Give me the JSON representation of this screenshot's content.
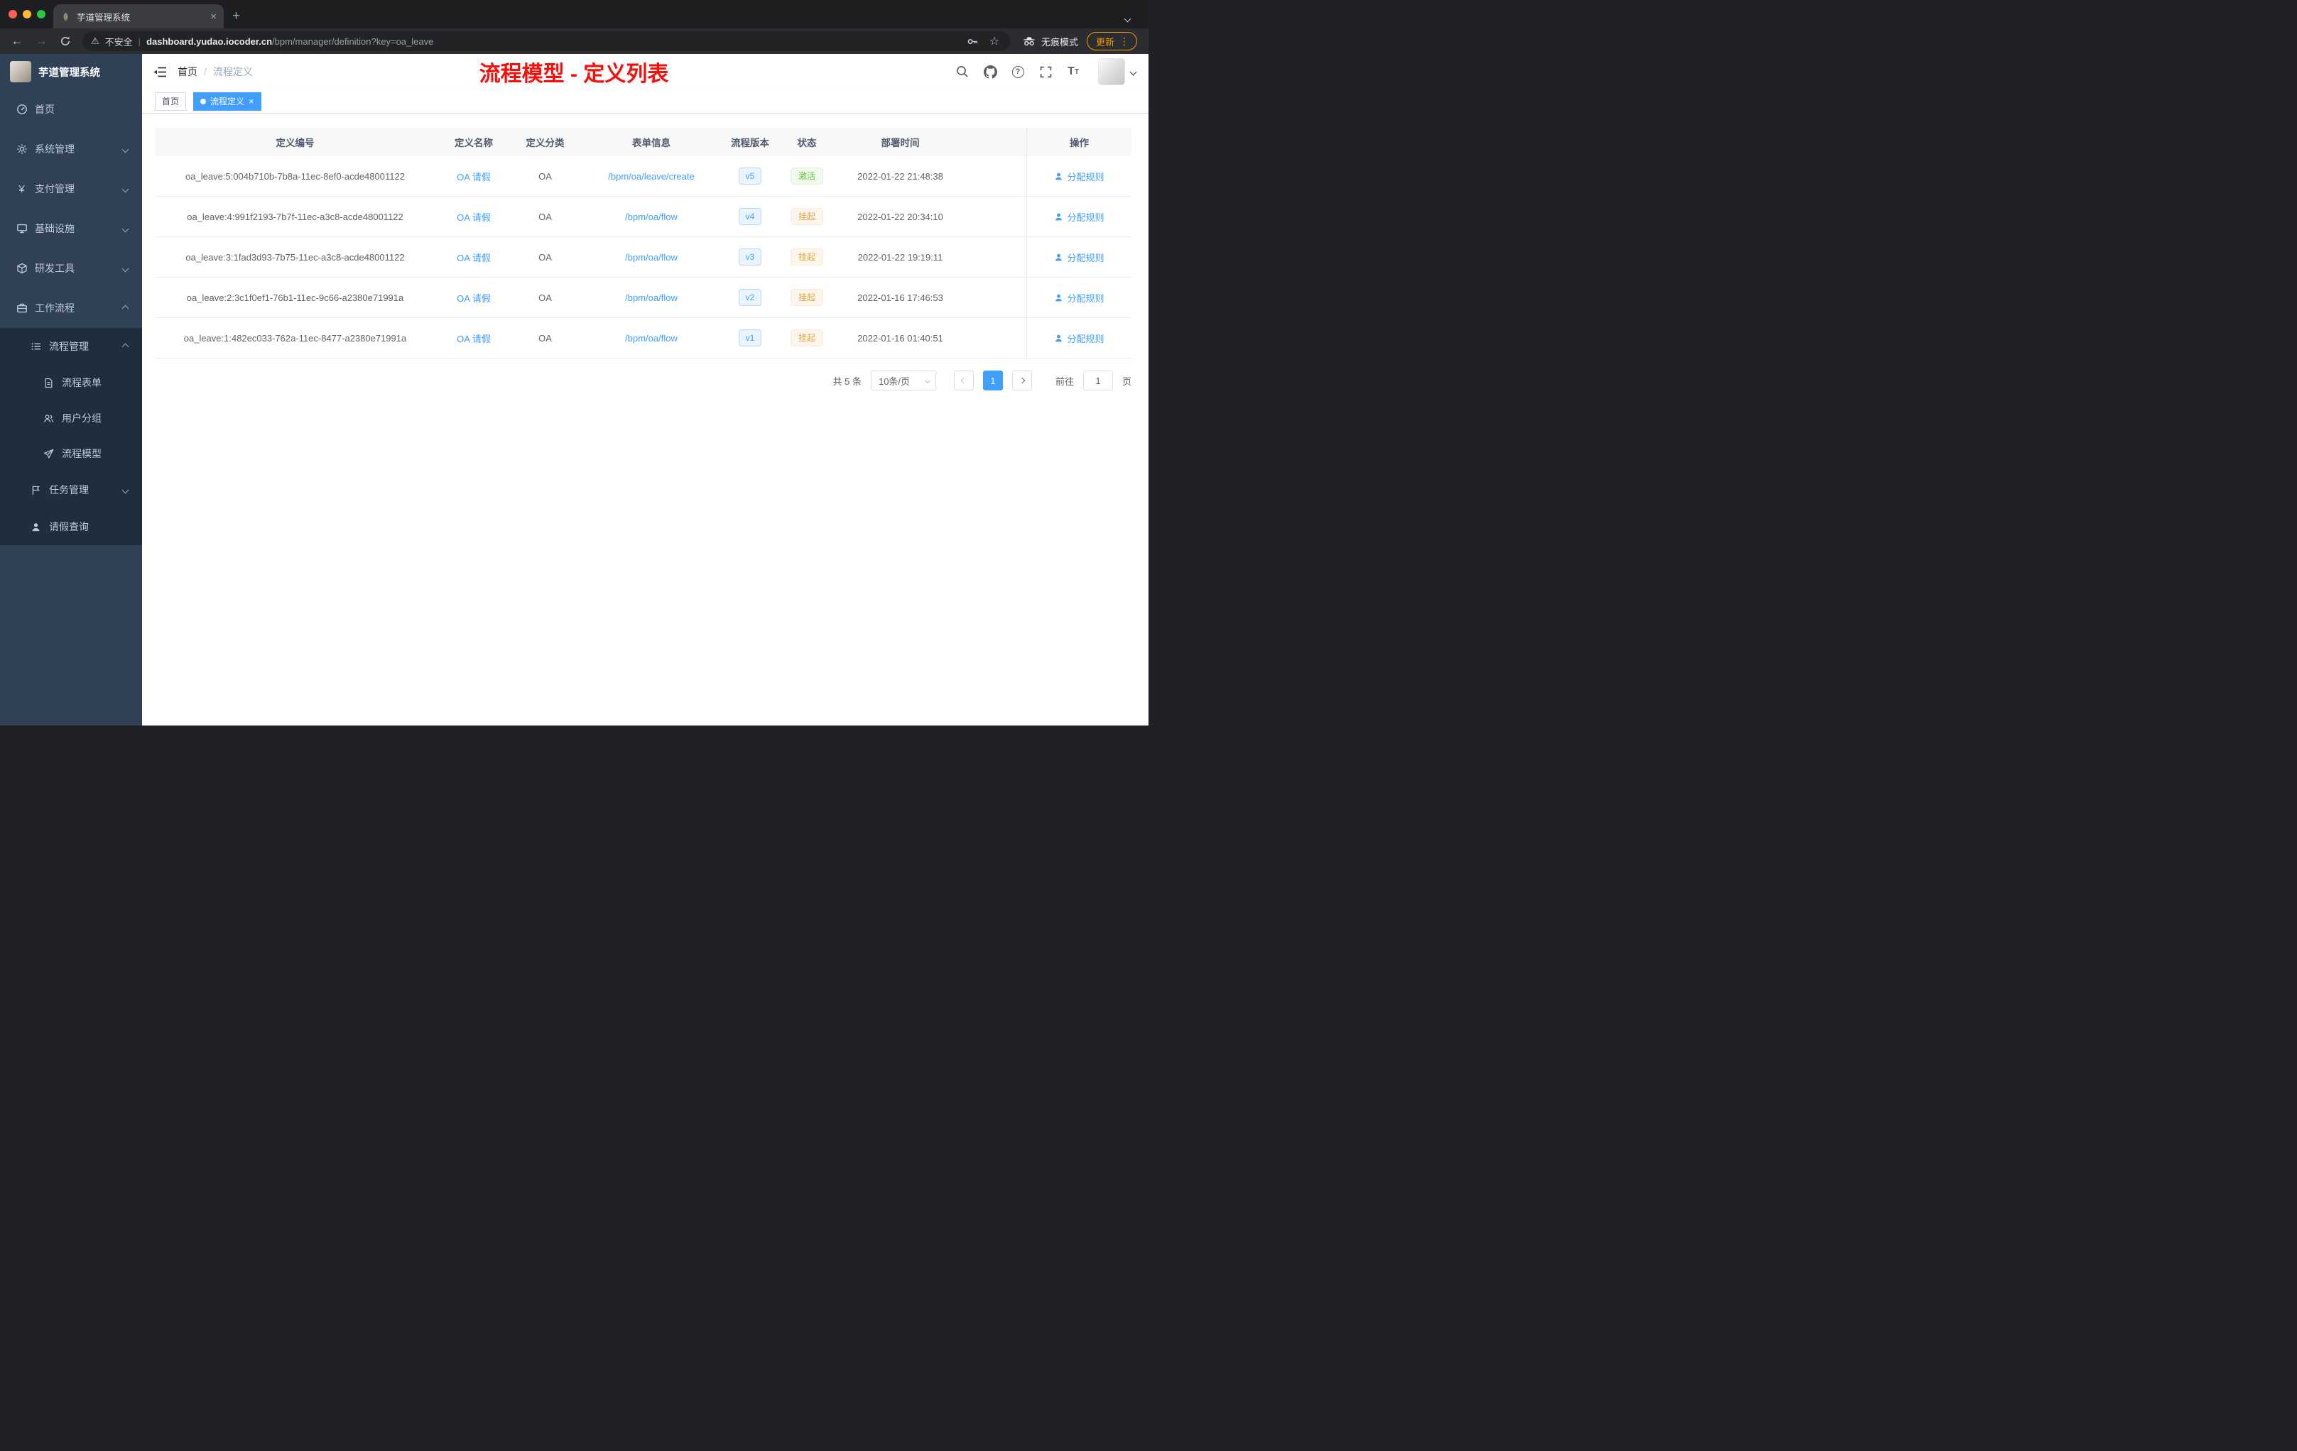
{
  "browser": {
    "tab_title": "芋道管理系统",
    "address": {
      "security_label": "不安全",
      "host": "dashboard.yudao.iocoder.cn",
      "path": "/bpm/manager/definition?key=oa_leave"
    },
    "incognito_label": "无痕模式",
    "update_label": "更新"
  },
  "icons": {
    "close": "×",
    "plus": "+",
    "back": "←",
    "forward": "→",
    "star": "☆",
    "warning": "⚠",
    "kebab": "⋮",
    "divider": "|",
    "yen": "¥",
    "question": "?",
    "font_size": "T"
  },
  "sidebar": {
    "logo_title": "芋道管理系统",
    "items": [
      {
        "label": "首页"
      },
      {
        "label": "系统管理"
      },
      {
        "label": "支付管理"
      },
      {
        "label": "基础设施"
      },
      {
        "label": "研发工具"
      },
      {
        "label": "工作流程"
      },
      {
        "label": "流程管理"
      },
      {
        "label": "流程表单"
      },
      {
        "label": "用户分组"
      },
      {
        "label": "流程模型"
      },
      {
        "label": "任务管理"
      },
      {
        "label": "请假查询"
      }
    ]
  },
  "header": {
    "breadcrumb_home": "首页",
    "breadcrumb_separator": "/",
    "breadcrumb_current": "流程定义",
    "annotation": "流程模型 - 定义列表"
  },
  "tags": {
    "home": "首页",
    "active": "流程定义"
  },
  "table": {
    "columns": [
      "定义编号",
      "定义名称",
      "定义分类",
      "表单信息",
      "流程版本",
      "状态",
      "部署时间",
      "操作"
    ],
    "rows": [
      {
        "id": "oa_leave:5:004b710b-7b8a-11ec-8ef0-acde48001122",
        "name": "OA 请假",
        "category": "OA",
        "form": "/bpm/oa/leave/create",
        "version": "v5",
        "status": "激活",
        "status_type": "success",
        "deploy_time": "2022-01-22 21:48:38",
        "action": "分配规则"
      },
      {
        "id": "oa_leave:4:991f2193-7b7f-11ec-a3c8-acde48001122",
        "name": "OA 请假",
        "category": "OA",
        "form": "/bpm/oa/flow",
        "version": "v4",
        "status": "挂起",
        "status_type": "warning",
        "deploy_time": "2022-01-22 20:34:10",
        "action": "分配规则"
      },
      {
        "id": "oa_leave:3:1fad3d93-7b75-11ec-a3c8-acde48001122",
        "name": "OA 请假",
        "category": "OA",
        "form": "/bpm/oa/flow",
        "version": "v3",
        "status": "挂起",
        "status_type": "warning",
        "deploy_time": "2022-01-22 19:19:11",
        "action": "分配规则"
      },
      {
        "id": "oa_leave:2:3c1f0ef1-76b1-11ec-9c66-a2380e71991a",
        "name": "OA 请假",
        "category": "OA",
        "form": "/bpm/oa/flow",
        "version": "v2",
        "status": "挂起",
        "status_type": "warning",
        "deploy_time": "2022-01-16 17:46:53",
        "action": "分配规则"
      },
      {
        "id": "oa_leave:1:482ec033-762a-11ec-8477-a2380e71991a",
        "name": "OA 请假",
        "category": "OA",
        "form": "/bpm/oa/flow",
        "version": "v1",
        "status": "挂起",
        "status_type": "warning",
        "deploy_time": "2022-01-16 01:40:51",
        "action": "分配规则"
      }
    ]
  },
  "pagination": {
    "total": "共 5 条",
    "page_size": "10条/页",
    "current_page": "1",
    "goto_label": "前往",
    "goto_value": "1",
    "page_unit": "页"
  },
  "colors": {
    "accent": "#409EFF",
    "success": "#67C23A",
    "warning": "#E6A23C",
    "annotation_red": "#F70D09",
    "sidebar_bg": "#304156",
    "submenu_bg": "#1F2D3D"
  }
}
